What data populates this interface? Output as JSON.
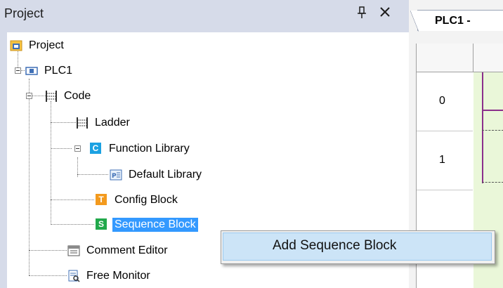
{
  "panel": {
    "title": "Project",
    "pin_glyph": "📌",
    "close_glyph": "✕"
  },
  "tree": {
    "root": "Project",
    "plc": "PLC1",
    "code": "Code",
    "ladder": "Ladder",
    "function_library": "Function Library",
    "default_library": "Default Library",
    "config_block": "Config Block",
    "sequence_block": "Sequence Block",
    "comment_editor": "Comment Editor",
    "free_monitor": "Free Monitor",
    "letters": {
      "c": "C",
      "t": "T",
      "s": "S"
    }
  },
  "editor": {
    "tab_label": "PLC1 -",
    "rows": [
      "0",
      "1"
    ]
  },
  "context_menu": {
    "item": "Add Sequence Block"
  },
  "colors": {
    "selection": "#3399ff",
    "menu_hover": "#cce4f7",
    "rung_area": "#eaf7d9",
    "rail": "#8b2f8b"
  }
}
